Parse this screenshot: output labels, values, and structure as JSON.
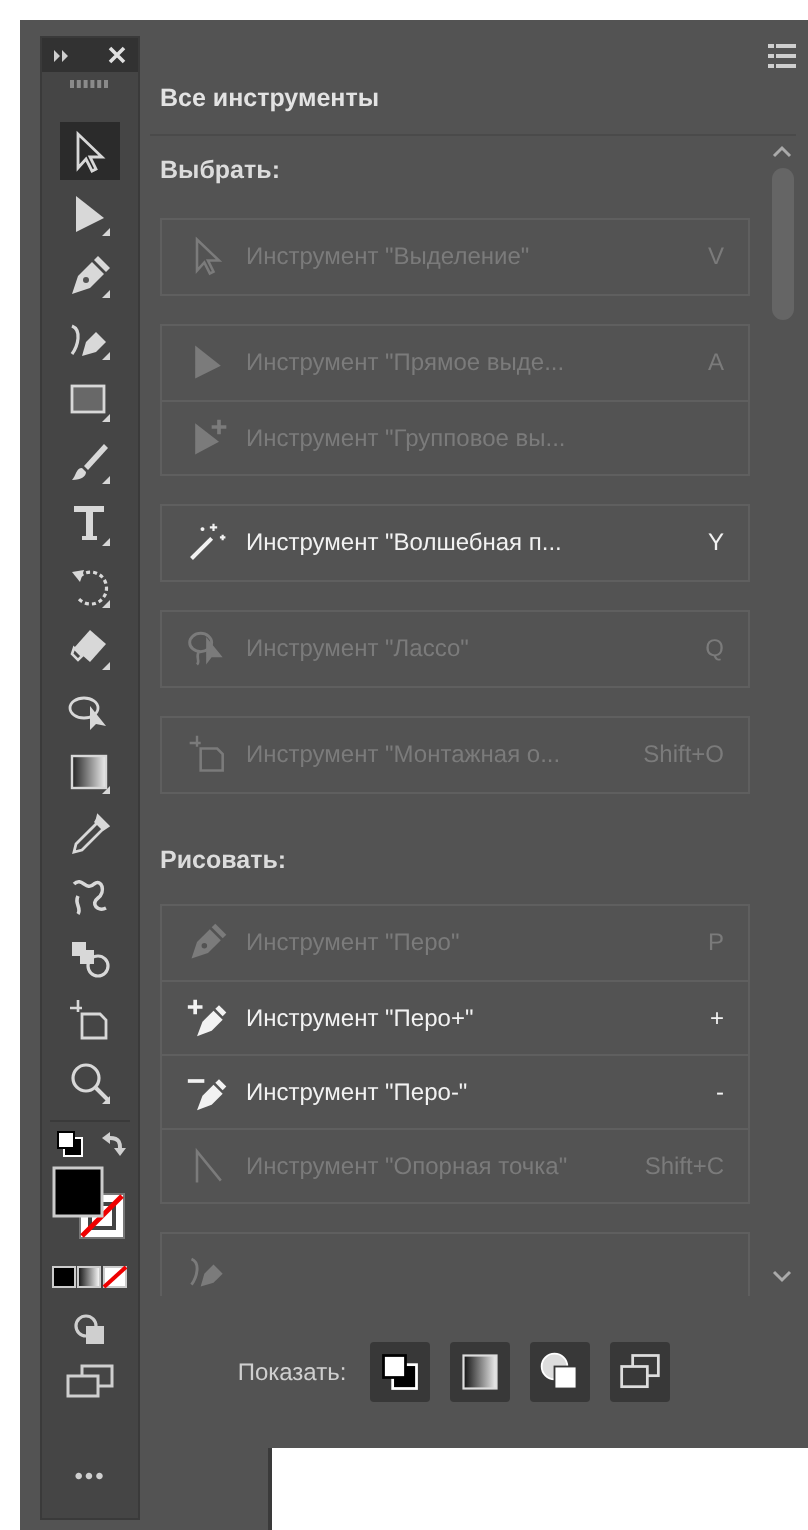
{
  "toolbar": {
    "tools": [
      {
        "kind": "select",
        "selected": true
      },
      {
        "kind": "direct-select",
        "selected": false
      },
      {
        "kind": "pen",
        "selected": false
      },
      {
        "kind": "curvature",
        "selected": false
      },
      {
        "kind": "rectangle",
        "selected": false
      },
      {
        "kind": "brush",
        "selected": false
      },
      {
        "kind": "type",
        "selected": false
      },
      {
        "kind": "rotate",
        "selected": false
      },
      {
        "kind": "eraser",
        "selected": false
      },
      {
        "kind": "shape-builder",
        "selected": false
      },
      {
        "kind": "gradient",
        "selected": false
      },
      {
        "kind": "eyedropper",
        "selected": false
      },
      {
        "kind": "puppet",
        "selected": false
      },
      {
        "kind": "blend",
        "selected": false
      },
      {
        "kind": "artboard",
        "selected": false
      },
      {
        "kind": "zoom",
        "selected": false
      }
    ],
    "more": "•••"
  },
  "panel": {
    "title": "Все инструменты",
    "sections": [
      {
        "heading": "Выбрать:",
        "groups": [
          {
            "items": [
              {
                "kind": "select",
                "label": "Инструмент \"Выделение\"",
                "shortcut": "V",
                "disabled": true
              }
            ]
          },
          {
            "items": [
              {
                "kind": "direct-select",
                "label": "Инструмент \"Прямое выде...",
                "shortcut": "A",
                "disabled": true
              },
              {
                "kind": "group-select",
                "label": "Инструмент \"Групповое вы...",
                "disabled": true
              }
            ]
          },
          {
            "items": [
              {
                "kind": "magic-wand",
                "label": "Инструмент \"Волшебная п...",
                "shortcut": "Y",
                "disabled": false
              }
            ]
          },
          {
            "items": [
              {
                "kind": "lasso",
                "label": "Инструмент \"Лассо\"",
                "shortcut": "Q",
                "disabled": true
              }
            ]
          },
          {
            "items": [
              {
                "kind": "artboard",
                "label": "Инструмент \"Монтажная о...",
                "shortcut": "Shift+O",
                "disabled": true
              }
            ]
          }
        ]
      },
      {
        "heading": "Рисовать:",
        "groups": [
          {
            "items": [
              {
                "kind": "pen",
                "label": "Инструмент \"Перо\"",
                "shortcut": "P",
                "disabled": true
              },
              {
                "kind": "pen-add",
                "label": "Инструмент \"Перо+\"",
                "shortcut": "+",
                "disabled": false
              },
              {
                "kind": "pen-delete",
                "label": "Инструмент \"Перо-\"",
                "shortcut": "-",
                "disabled": false
              },
              {
                "kind": "anchor",
                "label": "Инструмент \"Опорная точка\"",
                "shortcut": "Shift+C",
                "disabled": true
              }
            ]
          },
          {
            "items": [
              {
                "kind": "curvature"
              }
            ]
          }
        ]
      }
    ],
    "footer": {
      "label": "Показать:",
      "buttons": [
        {
          "kind": "swatches"
        },
        {
          "kind": "gradient"
        },
        {
          "kind": "draw-mode"
        },
        {
          "kind": "screen-mode"
        }
      ]
    }
  }
}
